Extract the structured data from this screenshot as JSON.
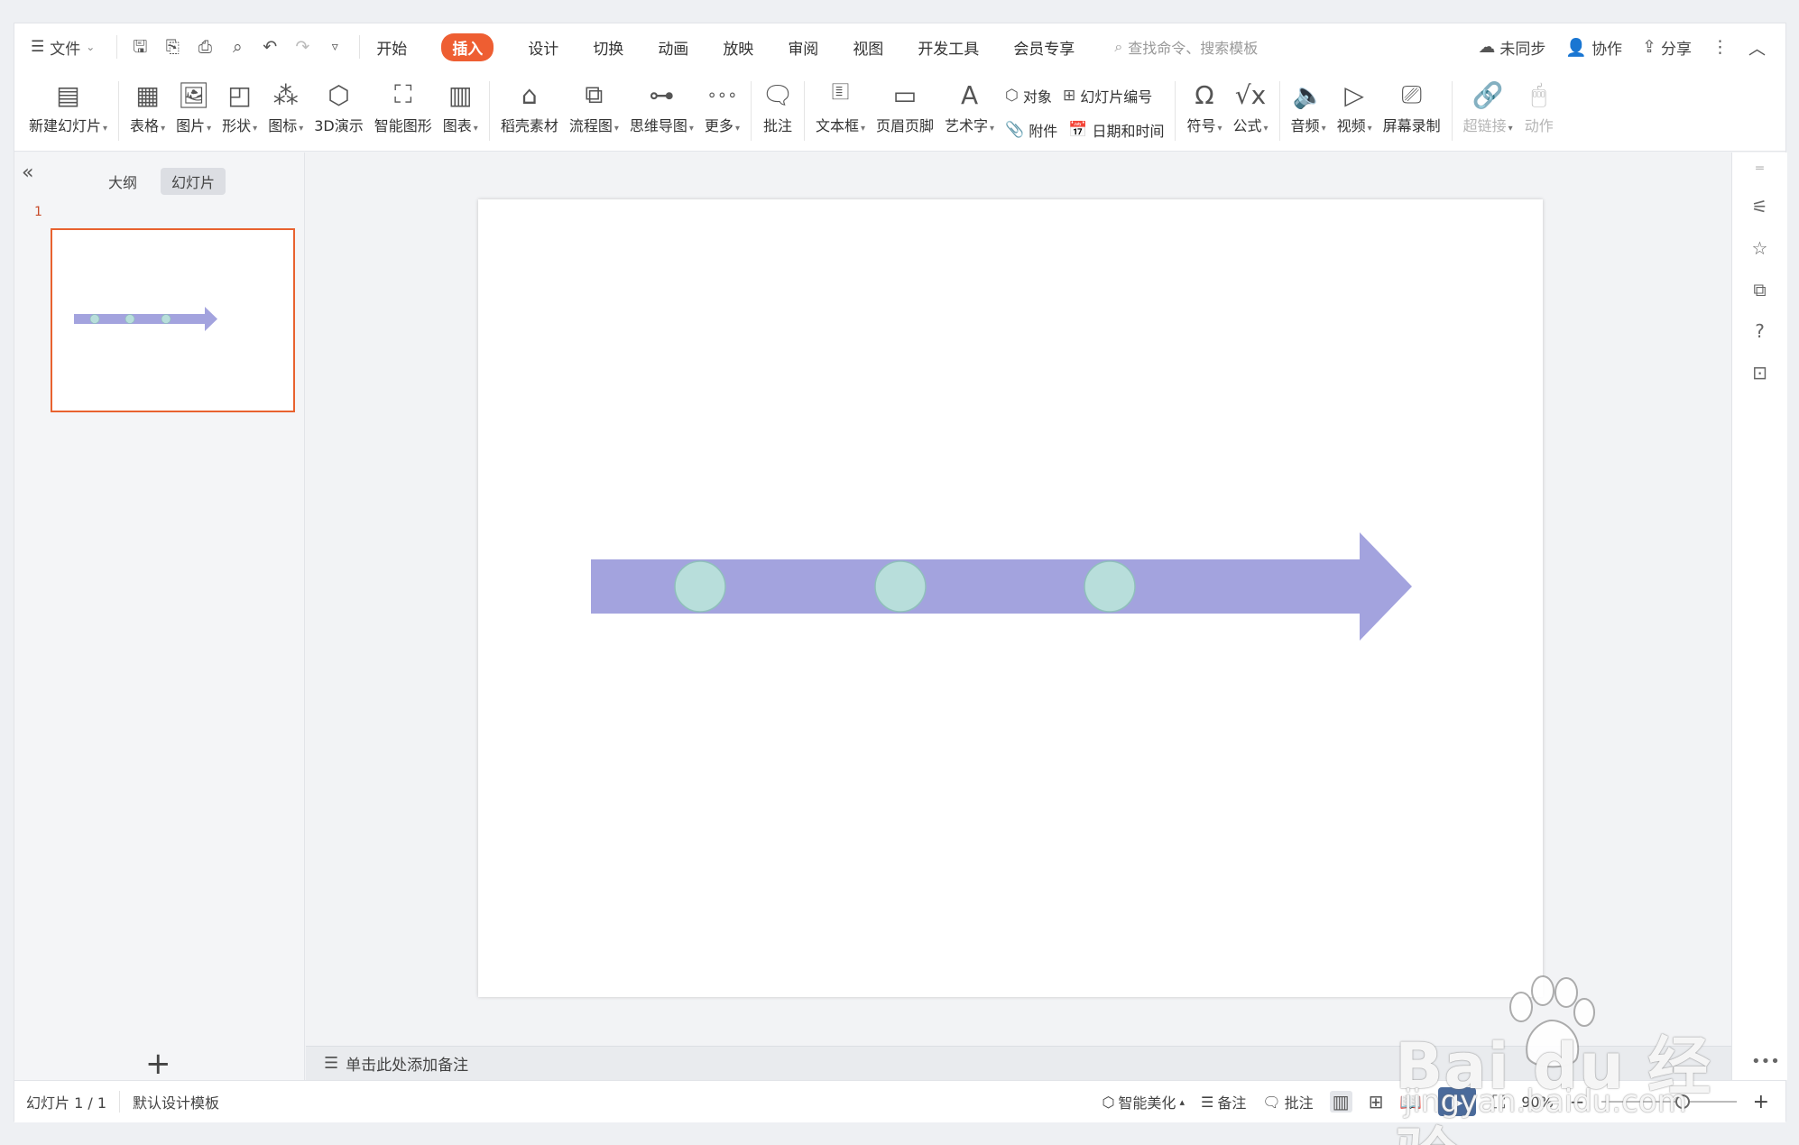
{
  "topbar": {
    "file_menu": "文件",
    "tabs": [
      "开始",
      "插入",
      "设计",
      "切换",
      "动画",
      "放映",
      "审阅",
      "视图",
      "开发工具",
      "会员专享"
    ],
    "active_tab": "插入",
    "search_placeholder": "查找命令、搜索模板",
    "sync_status": "未同步",
    "collab": "协作",
    "share": "分享"
  },
  "ribbon": {
    "new_slide": "新建幻灯片",
    "table": "表格",
    "picture": "图片",
    "shape": "形状",
    "icon": "图标",
    "three_d": "3D演示",
    "smart_shape": "智能图形",
    "chart": "图表",
    "shell_assets": "稻壳素材",
    "flowchart": "流程图",
    "mindmap": "思维导图",
    "more": "更多",
    "comment": "批注",
    "textbox": "文本框",
    "header_footer": "页眉页脚",
    "wordart": "艺术字",
    "object": "对象",
    "slide_number": "幻灯片编号",
    "attachment": "附件",
    "date_time": "日期和时间",
    "symbol": "符号",
    "formula": "公式",
    "audio": "音频",
    "video": "视频",
    "screen_record": "屏幕录制",
    "hyperlink": "超链接",
    "action": "动作"
  },
  "left_panel": {
    "tab_outline": "大纲",
    "tab_slides": "幻灯片",
    "thumb_number": "1"
  },
  "slide": {
    "arrow_color": "#a3a3de",
    "circle_color": "#b8dedb",
    "circle_stroke": "#8fbfbb"
  },
  "notes": {
    "placeholder": "单击此处添加备注"
  },
  "status": {
    "slide_counter": "幻灯片 1 / 1",
    "template": "默认设计模板",
    "beautify": "智能美化",
    "notes_btn": "备注",
    "comment_btn": "批注",
    "zoom": "90%"
  },
  "watermark": {
    "main": "Bai du 经验",
    "sub": "jingyan.baidu.com"
  },
  "colors": {
    "accent": "#ee5e32",
    "thumb_border": "#e8622f"
  }
}
